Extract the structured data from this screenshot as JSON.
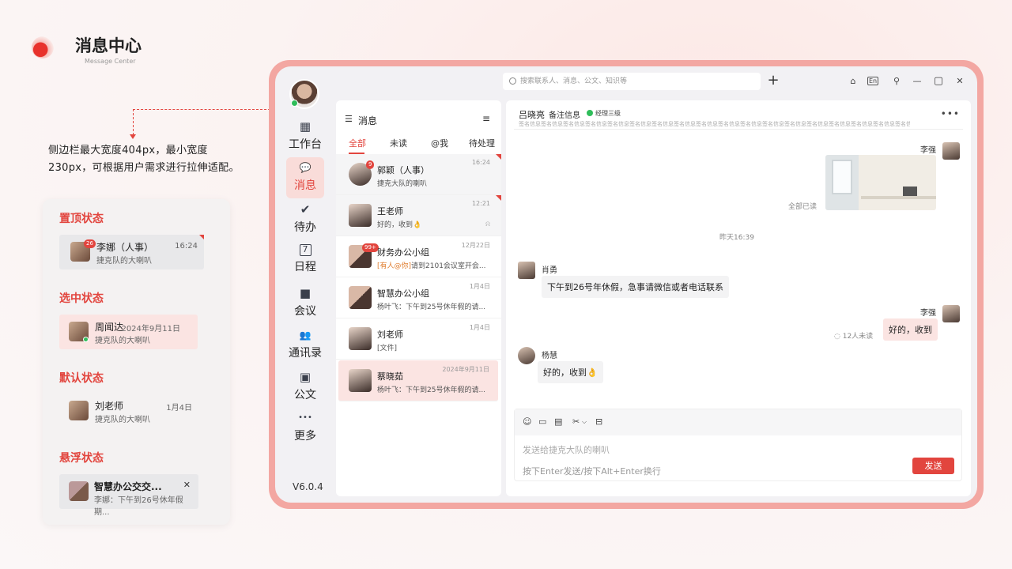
{
  "header": {
    "title": "消息中心",
    "subtitle": "Message Center"
  },
  "note": "侧边栏最大宽度404px，最小宽度230px，可根据用户需求进行拉伸适配。",
  "states": {
    "pinned": {
      "title": "置顶状态",
      "name": "李娜（人事）",
      "message": "捷克队的大喇叭",
      "time": "16:24",
      "badge": "26"
    },
    "selected": {
      "title": "选中状态",
      "name": "周闻达",
      "message": "捷克队的大喇叭",
      "time": "2024年9月11日"
    },
    "default": {
      "title": "默认状态",
      "name": "刘老师",
      "message": "捷克队的大喇叭",
      "time": "1月4日"
    },
    "hover": {
      "title": "悬浮状态",
      "name": "智慧办公交交...",
      "message": "李娜：下午到26号休年假期...",
      "close": "✕"
    }
  },
  "app": {
    "search_placeholder": "搜索联系人、消息、公文、知识等",
    "add": "+",
    "window_icons": [
      "home-icon",
      "lang-icon",
      "pin-icon",
      "minimize-icon",
      "maximize-icon",
      "close-icon"
    ],
    "window_glyphs": {
      "home": "⌂",
      "lang": "En",
      "pin": "⚲",
      "min": "—",
      "max": "▢",
      "close": "✕"
    },
    "nav": [
      {
        "label": "工作台",
        "icon": "▦"
      },
      {
        "label": "消息",
        "icon": "💬"
      },
      {
        "label": "待办",
        "icon": "✔"
      },
      {
        "label": "日程",
        "icon": "7"
      },
      {
        "label": "会议",
        "icon": "■"
      },
      {
        "label": "通讯录",
        "icon": "👥"
      },
      {
        "label": "公文",
        "icon": "▣"
      },
      {
        "label": "更多",
        "icon": "•••"
      }
    ],
    "version": "V6.0.4",
    "list": {
      "title": "消息",
      "menu_glyph": "☰",
      "more_glyph": "≡",
      "tabs": [
        "全部",
        "未读",
        "@我",
        "待处理"
      ],
      "conversations": [
        {
          "name": "郭颖（人事）",
          "message": "捷克大队的喇叭",
          "time": "16:24",
          "badge": "9"
        },
        {
          "name": "王老师",
          "message": "好的，收到👌",
          "time": "12:21"
        },
        {
          "name": "财务办公小组",
          "mention": "[有人@你]",
          "message": "请到2101会议室开会...",
          "time": "12月22日",
          "badge": "99+"
        },
        {
          "name": "智慧办公小组",
          "message": "杨叶飞：下午到25号休年假的请...",
          "time": "1月4日"
        },
        {
          "name": "刘老师",
          "message": "[文件]",
          "time": "1月4日"
        },
        {
          "name": "蔡晓茹",
          "message": "杨叶飞：下午到25号休年假的请...",
          "time": "2024年9月11日"
        }
      ]
    },
    "chat": {
      "name": "吕晓亮",
      "remark": "备注信息",
      "level": "经理三级",
      "signature": "签名信息签名信息签名信息签名信息签名信息签名信息签名信息签名信息签名信息签名信息签名信息签名信息签名信息签名信息签名信息签名信息签名信息签名信息签名信息签名信息签名信息签名信息",
      "more": "•••",
      "messages": [
        {
          "sender": "李强",
          "read": "全部已读"
        },
        {
          "timestamp": "昨天16:39"
        },
        {
          "sender": "肖勇",
          "text": "下午到26号年休假，急事请微信或者电话联系"
        },
        {
          "sender": "李强",
          "text": "好的，收到",
          "read": "12人未读"
        },
        {
          "sender": "杨慧",
          "text": "好的，收到👌"
        }
      ],
      "composer": {
        "tool_glyphs": [
          "☺",
          "▭",
          "▤",
          "✂",
          "⌵",
          "⊟"
        ],
        "placeholder": "发送给捷克大队的喇叭",
        "hint": "按下Enter发送/按下Alt+Enter换行",
        "send": "发送"
      }
    }
  }
}
